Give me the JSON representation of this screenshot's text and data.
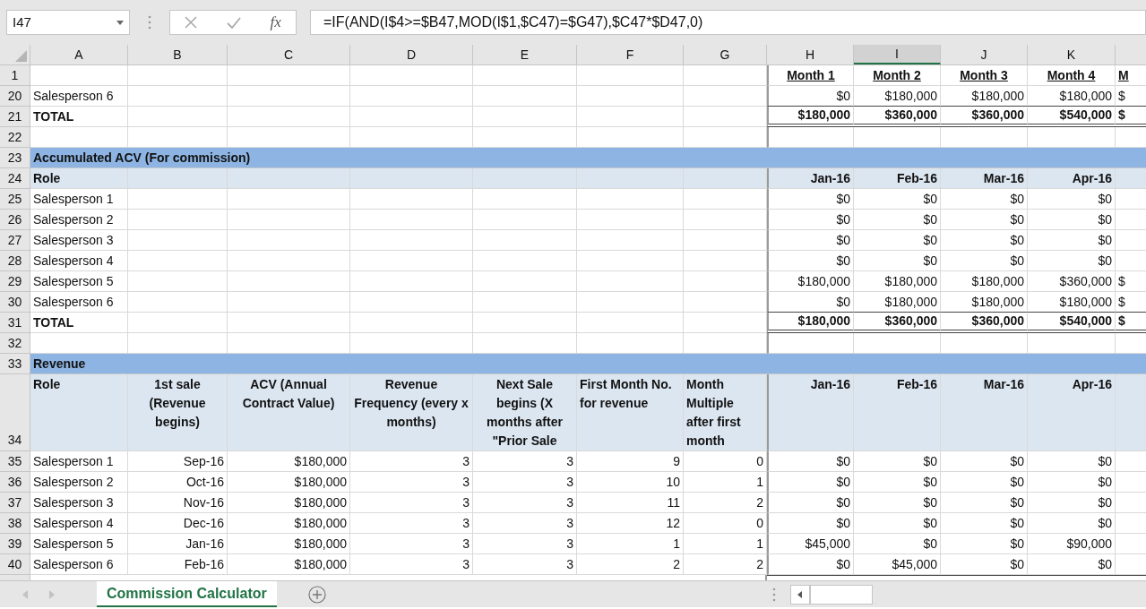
{
  "name_box": {
    "value": "I47"
  },
  "formula_bar": {
    "function_label": "fx",
    "value": "=IF(AND(I$4>=$B47,MOD(I$1,$C47)=$G47),$C47*$D47,0)"
  },
  "columns": [
    {
      "label": "A",
      "selected": false
    },
    {
      "label": "B",
      "selected": false
    },
    {
      "label": "C",
      "selected": false
    },
    {
      "label": "D",
      "selected": false
    },
    {
      "label": "E",
      "selected": false
    },
    {
      "label": "F",
      "selected": false
    },
    {
      "label": "G",
      "selected": false
    },
    {
      "label": "H",
      "selected": false
    },
    {
      "label": "I",
      "selected": true
    },
    {
      "label": "J",
      "selected": false
    },
    {
      "label": "K",
      "selected": false
    }
  ],
  "rows": [
    {
      "number": "1",
      "kind": "months",
      "cells": [
        null,
        null,
        null,
        null,
        null,
        null,
        null,
        "Month 1",
        "Month 2",
        "Month 3",
        "Month 4",
        "M"
      ]
    },
    {
      "number": "20",
      "kind": "plain",
      "cells": [
        "Salesperson 6",
        null,
        null,
        null,
        null,
        null,
        null,
        "$0",
        "$180,000",
        "$180,000",
        "$180,000",
        "$"
      ]
    },
    {
      "number": "21",
      "kind": "total",
      "cells": [
        "TOTAL",
        null,
        null,
        null,
        null,
        null,
        null,
        "$180,000",
        "$360,000",
        "$360,000",
        "$540,000",
        "$"
      ]
    },
    {
      "number": "22",
      "kind": "blank"
    },
    {
      "number": "23",
      "kind": "section",
      "title": "Accumulated ACV (For commission)"
    },
    {
      "number": "24",
      "kind": "subheader",
      "cells": [
        "Role",
        null,
        null,
        null,
        null,
        null,
        null,
        "Jan-16",
        "Feb-16",
        "Mar-16",
        "Apr-16",
        null
      ]
    },
    {
      "number": "25",
      "kind": "plain",
      "cells": [
        "Salesperson 1",
        null,
        null,
        null,
        null,
        null,
        null,
        "$0",
        "$0",
        "$0",
        "$0",
        null
      ]
    },
    {
      "number": "26",
      "kind": "plain",
      "cells": [
        "Salesperson 2",
        null,
        null,
        null,
        null,
        null,
        null,
        "$0",
        "$0",
        "$0",
        "$0",
        null
      ]
    },
    {
      "number": "27",
      "kind": "plain",
      "cells": [
        "Salesperson 3",
        null,
        null,
        null,
        null,
        null,
        null,
        "$0",
        "$0",
        "$0",
        "$0",
        null
      ]
    },
    {
      "number": "28",
      "kind": "plain",
      "cells": [
        "Salesperson 4",
        null,
        null,
        null,
        null,
        null,
        null,
        "$0",
        "$0",
        "$0",
        "$0",
        null
      ]
    },
    {
      "number": "29",
      "kind": "plain",
      "cells": [
        "Salesperson 5",
        null,
        null,
        null,
        null,
        null,
        null,
        "$180,000",
        "$180,000",
        "$180,000",
        "$360,000",
        "$"
      ]
    },
    {
      "number": "30",
      "kind": "plain",
      "cells": [
        "Salesperson 6",
        null,
        null,
        null,
        null,
        null,
        null,
        "$0",
        "$180,000",
        "$180,000",
        "$180,000",
        "$"
      ]
    },
    {
      "number": "31",
      "kind": "total",
      "cells": [
        "TOTAL",
        null,
        null,
        null,
        null,
        null,
        null,
        "$180,000",
        "$360,000",
        "$360,000",
        "$540,000",
        "$"
      ]
    },
    {
      "number": "32",
      "kind": "blank"
    },
    {
      "number": "33",
      "kind": "section",
      "title": "Revenue"
    },
    {
      "number": "34",
      "kind": "header",
      "cells": [
        "Role",
        "1st sale (Revenue begins)",
        "ACV (Annual Contract Value)",
        "Revenue Frequency (every x months)",
        "Next Sale begins (X months after \"Prior Sale",
        "First Month No. for revenue",
        "Month Multiple after first month",
        "Jan-16",
        "Feb-16",
        "Mar-16",
        "Apr-16",
        null
      ]
    },
    {
      "number": "35",
      "kind": "plain",
      "cells": [
        "Salesperson 1",
        "Sep-16",
        "$180,000",
        "3",
        "3",
        "9",
        "0",
        "$0",
        "$0",
        "$0",
        "$0",
        null
      ]
    },
    {
      "number": "36",
      "kind": "plain",
      "cells": [
        "Salesperson 2",
        "Oct-16",
        "$180,000",
        "3",
        "3",
        "10",
        "1",
        "$0",
        "$0",
        "$0",
        "$0",
        null
      ]
    },
    {
      "number": "37",
      "kind": "plain",
      "cells": [
        "Salesperson 3",
        "Nov-16",
        "$180,000",
        "3",
        "3",
        "11",
        "2",
        "$0",
        "$0",
        "$0",
        "$0",
        null
      ]
    },
    {
      "number": "38",
      "kind": "plain",
      "cells": [
        "Salesperson 4",
        "Dec-16",
        "$180,000",
        "3",
        "3",
        "12",
        "0",
        "$0",
        "$0",
        "$0",
        "$0",
        null
      ]
    },
    {
      "number": "39",
      "kind": "plain",
      "cells": [
        "Salesperson 5",
        "Jan-16",
        "$180,000",
        "3",
        "3",
        "1",
        "1",
        "$45,000",
        "$0",
        "$0",
        "$90,000",
        null
      ]
    },
    {
      "number": "40",
      "kind": "plain",
      "cells": [
        "Salesperson 6",
        "Feb-16",
        "$180,000",
        "3",
        "3",
        "2",
        "2",
        "$0",
        "$45,000",
        "$0",
        "$0",
        null
      ]
    }
  ],
  "sheet_tabs": [
    {
      "label": "Commission Calculator",
      "selected": true
    }
  ]
}
